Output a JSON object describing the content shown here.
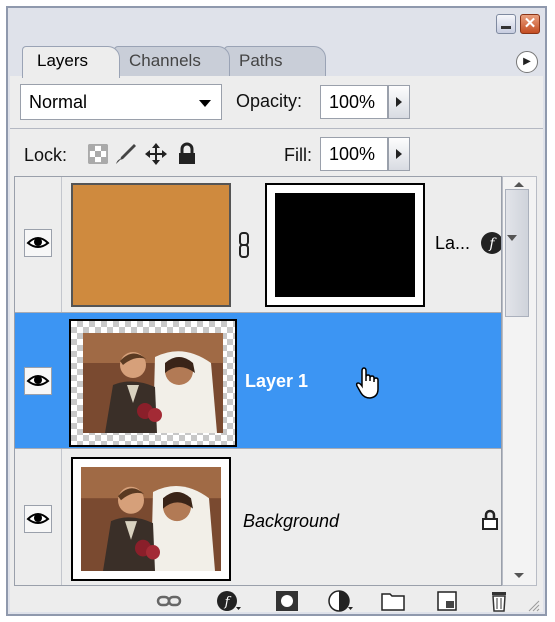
{
  "tabs": [
    {
      "label": "Layers",
      "active": true
    },
    {
      "label": "Channels",
      "active": false
    },
    {
      "label": "Paths",
      "active": false
    }
  ],
  "window": {
    "minimize_icon": "minimize-icon",
    "close_icon": "close-icon",
    "close_glyph": "✕",
    "menu_glyph": "▶"
  },
  "blend": {
    "mode": "Normal",
    "opacity_label": "Opacity:",
    "opacity_value": "100%"
  },
  "lock": {
    "label": "Lock:",
    "icons": [
      "lock-transparent-pixels-icon",
      "lock-image-pixels-icon",
      "lock-position-icon",
      "lock-all-icon"
    ],
    "fill_label": "Fill:",
    "fill_value": "100%"
  },
  "layers": [
    {
      "name": "La...",
      "type": "adjustment",
      "fill_color": "#cf8a3e",
      "mask": "#000000",
      "visible": true,
      "selected": false,
      "fx": true
    },
    {
      "name": "Layer 1",
      "type": "pixel",
      "visible": true,
      "selected": true,
      "transparent_border": true
    },
    {
      "name": "Background",
      "type": "background",
      "visible": true,
      "selected": false,
      "locked": true
    }
  ],
  "bottom_icons": [
    "link-layers-icon",
    "layer-style-icon",
    "layer-mask-icon",
    "new-adjustment-layer-icon",
    "new-group-icon",
    "new-layer-icon",
    "delete-layer-icon"
  ],
  "colors": {
    "selection": "#3c95f3",
    "panel": "#ededed",
    "fill_layer": "#cf8a3e"
  }
}
